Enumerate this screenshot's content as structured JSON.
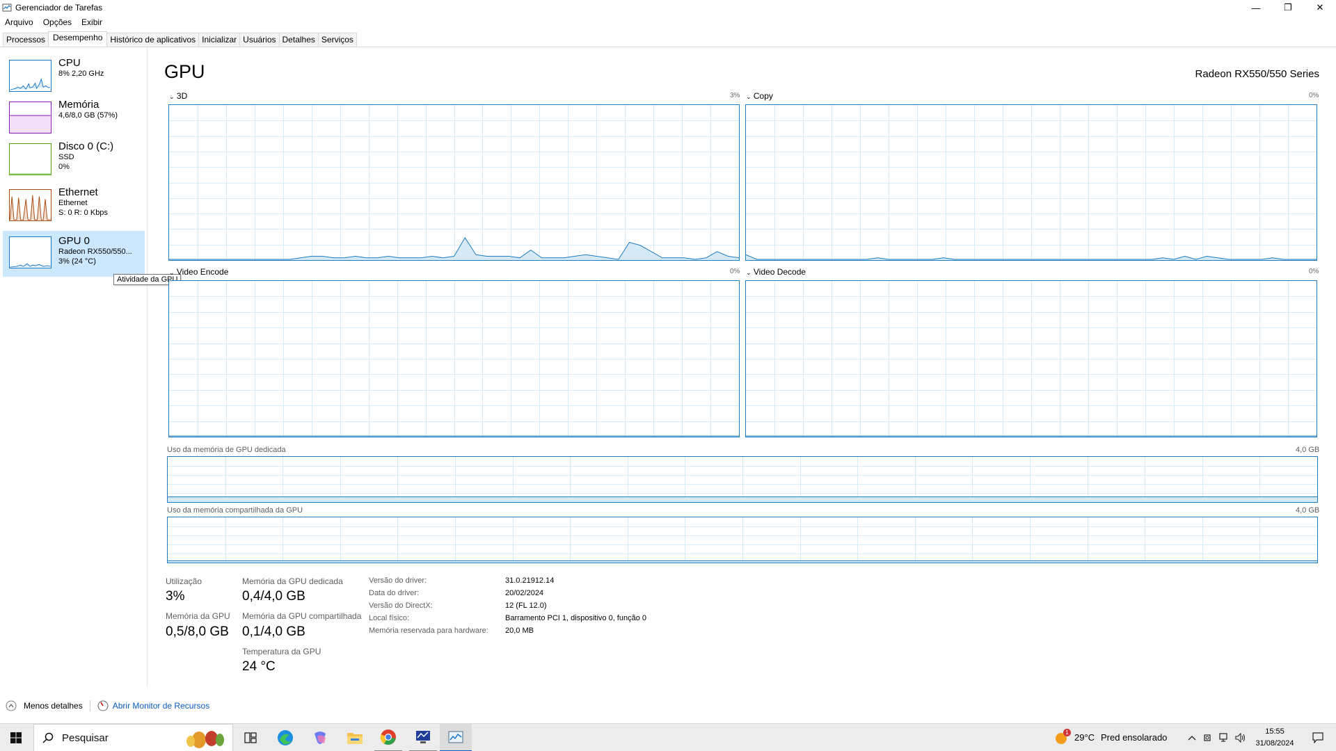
{
  "window": {
    "title": "Gerenciador de Tarefas"
  },
  "menu": [
    "Arquivo",
    "Opções",
    "Exibir"
  ],
  "tabs": [
    {
      "label": "Processos",
      "active": false
    },
    {
      "label": "Desempenho",
      "active": true
    },
    {
      "label": "Histórico de aplicativos",
      "active": false
    },
    {
      "label": "Inicializar",
      "active": false
    },
    {
      "label": "Usuários",
      "active": false
    },
    {
      "label": "Detalhes",
      "active": false
    },
    {
      "label": "Serviços",
      "active": false
    }
  ],
  "sidebar": {
    "items": [
      {
        "title": "CPU",
        "line1": "8%  2,20 GHz",
        "line2": "",
        "line3": "",
        "color": "#1a76c5"
      },
      {
        "title": "Memória",
        "line1": "4,6/8,0 GB (57%)",
        "line2": "",
        "line3": "",
        "color": "#8b18b0"
      },
      {
        "title": "Disco 0 (C:)",
        "line1": "SSD",
        "line2": "0%",
        "line3": "",
        "color": "#4da60c"
      },
      {
        "title": "Ethernet",
        "line1": "Ethernet",
        "line2": "S: 0  R: 0 Kbps",
        "line3": "",
        "color": "#a7490f"
      },
      {
        "title": "GPU 0",
        "line1": "Radeon RX550/550...",
        "line2": "3%  (24 °C)",
        "line3": "",
        "color": "#1a76c5"
      }
    ],
    "tooltip": "Atividade da GPU"
  },
  "main": {
    "title": "GPU",
    "model": "Radeon RX550/550 Series",
    "engines": [
      {
        "label": "3D",
        "pct": "3%"
      },
      {
        "label": "Copy",
        "pct": "0%"
      },
      {
        "label": "Video Encode",
        "pct": "0%"
      },
      {
        "label": "Video Decode",
        "pct": "0%"
      }
    ],
    "dedicated": {
      "label": "Uso da memória de GPU dedicada",
      "max": "4,0 GB"
    },
    "shared": {
      "label": "Uso da memória compartilhada da GPU",
      "max": "4,0 GB"
    }
  },
  "stats": {
    "util_label": "Utilização",
    "util_val": "3%",
    "gpu_mem_label": "Memória da GPU",
    "gpu_mem_val": "0,5/8,0 GB",
    "ded_label": "Memória da GPU dedicada",
    "ded_val": "0,4/4,0 GB",
    "shr_label": "Memória da GPU compartilhada",
    "shr_val": "0,1/4,0 GB",
    "temp_label": "Temperatura da GPU",
    "temp_val": "24 °C"
  },
  "info": [
    {
      "label": "Versão do driver:",
      "value": "31.0.21912.14"
    },
    {
      "label": "Data do driver:",
      "value": "20/02/2024"
    },
    {
      "label": "Versão do DirectX:",
      "value": "12 (FL 12.0)"
    },
    {
      "label": "Local físico:",
      "value": "Barramento PCI 1, dispositivo 0, função 0"
    },
    {
      "label": "Memória reservada para hardware:",
      "value": "20,0 MB"
    }
  ],
  "footer": {
    "less_details": "Menos detalhes",
    "resource_monitor": "Abrir Monitor de Recursos"
  },
  "taskbar": {
    "search_placeholder": "Pesquisar",
    "weather_temp": "29°C",
    "weather_text": "Pred ensolarado",
    "time": "15:55",
    "date": "31/08/2024",
    "weather_badge": "1"
  },
  "colors": {
    "accent": "#1e7dc0",
    "grid": "#d8ebf6",
    "selected": "#cce8ff"
  },
  "graph_data": {
    "gpu3d": [
      0,
      0,
      0,
      0,
      0,
      0,
      0,
      0,
      0,
      0,
      0,
      0,
      1,
      2,
      2,
      1,
      1,
      2,
      1,
      1,
      2,
      1,
      1,
      1,
      2,
      1,
      2,
      14,
      3,
      2,
      2,
      2,
      1,
      6,
      1,
      1,
      1,
      2,
      3,
      2,
      1,
      0,
      11,
      9,
      5,
      1,
      1,
      1,
      0,
      1,
      5,
      2,
      1
    ],
    "copy": [
      3,
      0,
      0,
      0,
      0,
      0,
      0,
      0,
      0,
      0,
      0,
      0,
      1,
      0,
      0,
      0,
      0,
      0,
      1,
      0,
      0,
      0,
      0,
      0,
      0,
      0,
      0,
      0,
      0,
      0,
      0,
      0,
      0,
      0,
      0,
      0,
      0,
      0,
      1,
      0,
      2,
      0,
      2,
      1,
      0,
      0,
      0,
      0,
      1,
      0,
      0,
      0,
      0
    ]
  }
}
